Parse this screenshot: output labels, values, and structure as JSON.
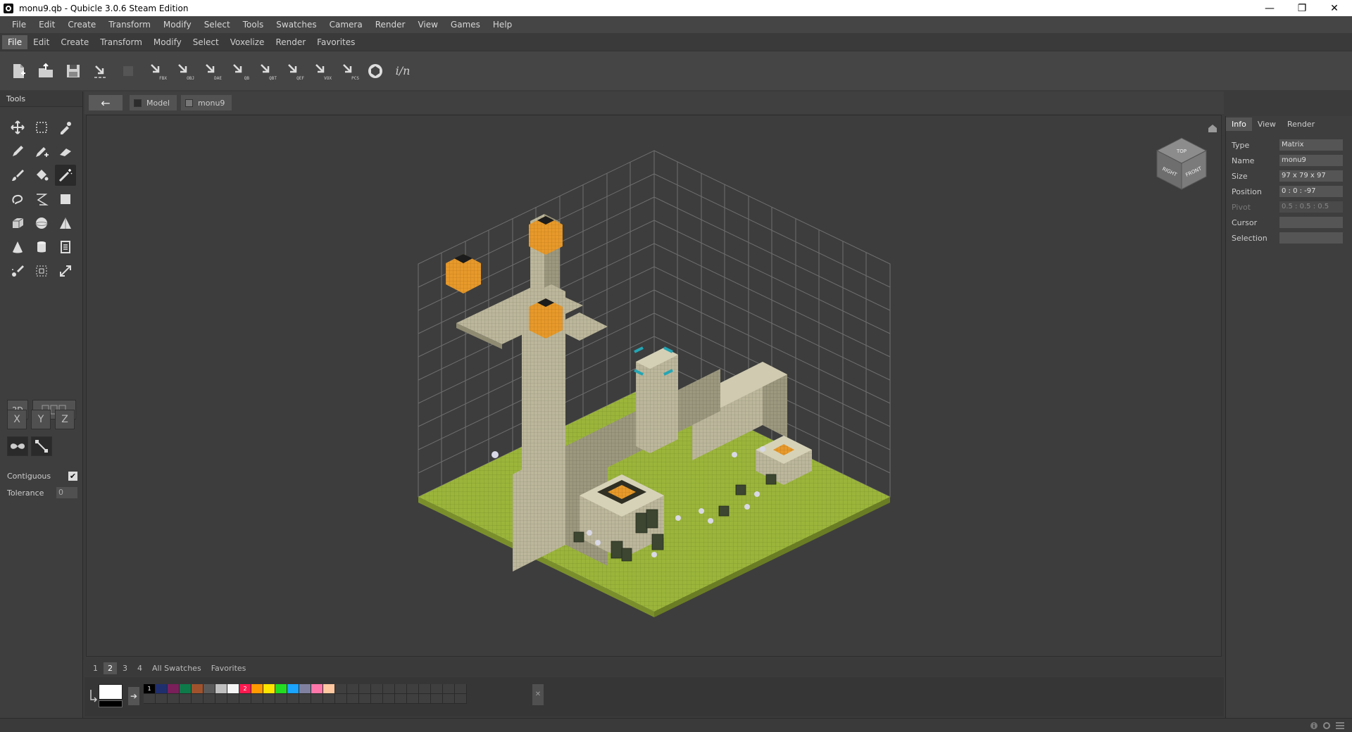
{
  "window": {
    "title": "monu9.qb - Qubicle 3.0.6 Steam Edition",
    "minimize_glyph": "—",
    "restore_glyph": "❐",
    "close_glyph": "✕"
  },
  "menubar_main": [
    {
      "label": "File"
    },
    {
      "label": "Edit"
    },
    {
      "label": "Create"
    },
    {
      "label": "Transform"
    },
    {
      "label": "Modify"
    },
    {
      "label": "Select"
    },
    {
      "label": "Tools"
    },
    {
      "label": "Swatches"
    },
    {
      "label": "Camera"
    },
    {
      "label": "Render"
    },
    {
      "label": "View"
    },
    {
      "label": "Games"
    },
    {
      "label": "Help"
    }
  ],
  "menubar_ribbon": [
    {
      "label": "File"
    },
    {
      "label": "Edit"
    },
    {
      "label": "Create"
    },
    {
      "label": "Transform"
    },
    {
      "label": "Modify"
    },
    {
      "label": "Select"
    },
    {
      "label": "Voxelize"
    },
    {
      "label": "Render"
    },
    {
      "label": "Favorites"
    }
  ],
  "toolbar": {
    "buttons": [
      {
        "icon": "new-file-icon"
      },
      {
        "icon": "open-file-icon"
      },
      {
        "icon": "save-icon"
      },
      {
        "icon": "export-icon"
      },
      {
        "icon": "export-disabled-icon"
      },
      {
        "icon": "export-fbx-icon",
        "label": "FBX"
      },
      {
        "icon": "export-obj-icon",
        "label": "OBJ"
      },
      {
        "icon": "export-dae-icon",
        "label": "DAE"
      },
      {
        "icon": "export-qb-icon",
        "label": "QB"
      },
      {
        "icon": "export-qbt-icon",
        "label": "QBT"
      },
      {
        "icon": "export-qef-icon",
        "label": "QEF"
      },
      {
        "icon": "export-vox-icon",
        "label": "VOX"
      },
      {
        "icon": "export-pcs-icon",
        "label": "PCS"
      },
      {
        "icon": "unity-icon"
      },
      {
        "icon": "signature-icon",
        "label": "i/n"
      }
    ]
  },
  "tools_panel": {
    "header": "Tools",
    "tools": [
      "move-icon",
      "select-box-icon",
      "eyedropper-icon",
      "pencil-icon",
      "pencil-plus-icon",
      "eraser-icon",
      "brush-icon",
      "fill-bucket-icon",
      "magic-wand-icon",
      "lasso-icon",
      "polygon-select-icon",
      "rectangle-icon",
      "cube-icon",
      "sphere-icon",
      "pyramid-icon",
      "cone-icon",
      "cylinder-icon",
      "text-icon",
      "scatter-brush-icon",
      "scale-select-icon",
      "resize-icon"
    ],
    "mode_2d": "2D",
    "axes": [
      "X",
      "Y",
      "Z"
    ],
    "contiguous_label": "Contiguous",
    "contiguous_checked": "✔",
    "tolerance_label": "Tolerance",
    "tolerance_value": "0"
  },
  "tabstrip": {
    "back_glyph": "←",
    "breadcrumbs": [
      {
        "label": "Model",
        "swatch": "#2c2c2c"
      },
      {
        "label": "monu9",
        "swatch": "#777777"
      }
    ]
  },
  "viewcube": {
    "top": "TOP",
    "right": "RIGHT",
    "front": "FRONT"
  },
  "properties": {
    "tabs": [
      "Info",
      "View",
      "Render"
    ],
    "rows": [
      {
        "label": "Type",
        "value": "Matrix",
        "dim": false
      },
      {
        "label": "Name",
        "value": "monu9",
        "dim": false
      },
      {
        "label": "Size",
        "value": "97 x 79 x 97",
        "dim": false
      },
      {
        "label": "Position",
        "value": "0 : 0 : -97",
        "dim": false
      },
      {
        "label": "Pivot",
        "value": "0.5 : 0.5 : 0.5",
        "dim": true
      },
      {
        "label": "Cursor",
        "value": "",
        "dim": false
      },
      {
        "label": "Selection",
        "value": "",
        "dim": false
      }
    ]
  },
  "swatches": {
    "tabs": [
      "1",
      "2",
      "3",
      "4",
      "All Swatches",
      "Favorites"
    ],
    "active_tab": "2",
    "primary_color": "#ffffff",
    "secondary_color": "#000000",
    "palette": [
      {
        "color": "#000000",
        "label": "1"
      },
      {
        "color": "#1f2f6e",
        "label": ""
      },
      {
        "color": "#7a1f5a",
        "label": ""
      },
      {
        "color": "#0e7a4a",
        "label": ""
      },
      {
        "color": "#a0522d",
        "label": ""
      },
      {
        "color": "#5a5a5a",
        "label": ""
      },
      {
        "color": "#c0c0c0",
        "label": ""
      },
      {
        "color": "#f5f5f5",
        "label": ""
      },
      {
        "color": "#ff1a4f",
        "label": "2"
      },
      {
        "color": "#ff9a00",
        "label": ""
      },
      {
        "color": "#ffe400",
        "label": ""
      },
      {
        "color": "#22dd22",
        "label": ""
      },
      {
        "color": "#1aa3ff",
        "label": ""
      },
      {
        "color": "#8080a0",
        "label": ""
      },
      {
        "color": "#ff77aa",
        "label": ""
      },
      {
        "color": "#ffc8a0",
        "label": ""
      }
    ],
    "close_glyph": "✕"
  }
}
